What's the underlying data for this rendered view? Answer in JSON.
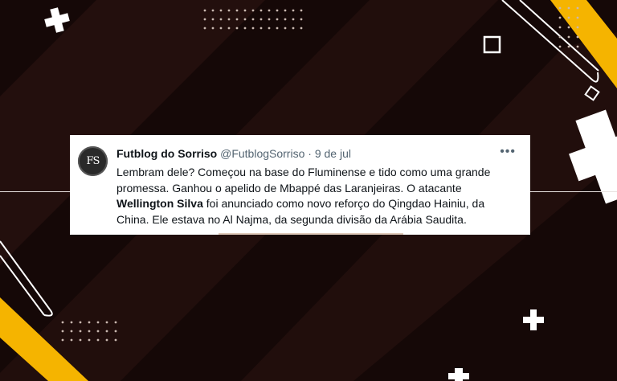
{
  "tweet": {
    "avatar_initials": "FS",
    "display_name": "Futblog do Sorriso",
    "handle": "@FutblogSorriso",
    "separator": "·",
    "date": "9 de jul",
    "more_label": "•••",
    "text_before": "Lembram dele? Começou na base do Fluminense e tido como uma grande promessa. Ganhou o apelido de Mbappé das Laranjeiras. O atacante ",
    "text_bold": "Wellington Silva",
    "text_after": " foi anunciado como novo reforço do Qingdao Hainiu, da China. Ele estava no Al Najma, da segunda divisão da Arábia Saudita."
  },
  "colors": {
    "background": "#150807",
    "accent_yellow": "#f5b400",
    "text_primary": "#0f1419",
    "text_secondary": "#536471"
  }
}
